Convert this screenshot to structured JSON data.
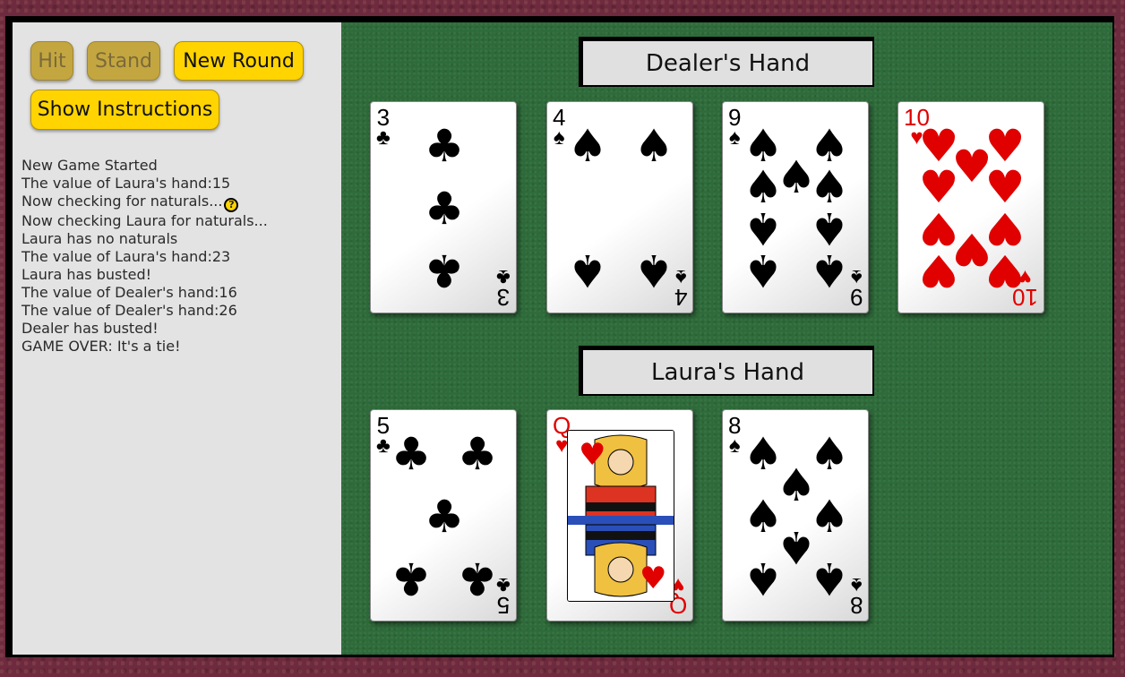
{
  "controls": {
    "hit_label": "Hit",
    "stand_label": "Stand",
    "new_round_label": "New Round",
    "instructions_label": "Show Instructions"
  },
  "log": [
    "New Game Started",
    "The value of Laura's hand:15",
    "Now checking for naturals...",
    "Now checking Laura for naturals...",
    "Laura has no naturals",
    "The value of Laura's hand:23",
    "Laura has busted!",
    "The value of Dealer's hand:16",
    "The value of Dealer's hand:26",
    "Dealer has busted!",
    "GAME OVER: It's a tie!"
  ],
  "dealer": {
    "title": "Dealer's Hand",
    "cards": [
      {
        "rank": "3",
        "suit": "clubs"
      },
      {
        "rank": "4",
        "suit": "spades"
      },
      {
        "rank": "9",
        "suit": "spades"
      },
      {
        "rank": "10",
        "suit": "hearts"
      }
    ]
  },
  "player": {
    "title": "Laura's Hand",
    "cards": [
      {
        "rank": "5",
        "suit": "clubs"
      },
      {
        "rank": "Q",
        "suit": "hearts"
      },
      {
        "rank": "8",
        "suit": "spades"
      }
    ]
  },
  "colors": {
    "felt": "#2e6b3a",
    "button": "#ffd400",
    "button_disabled": "#c4a640",
    "red_suit": "#e00000"
  }
}
